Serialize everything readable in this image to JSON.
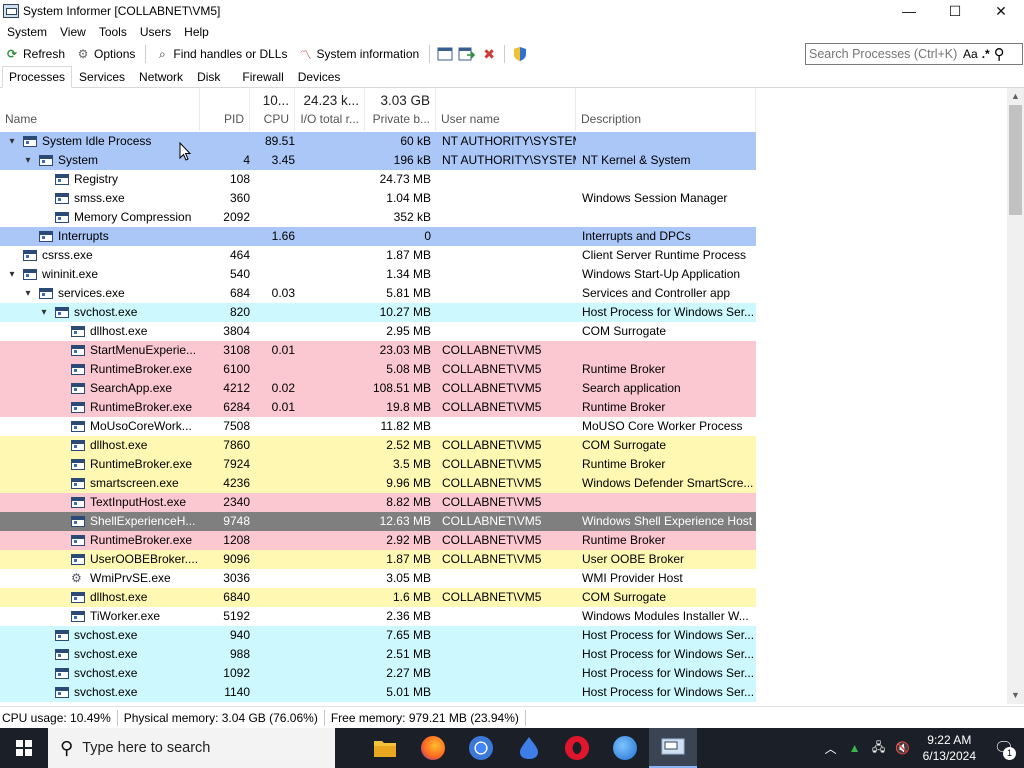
{
  "window": {
    "title": "System Informer [COLLABNET\\VM5]",
    "minimize": "—",
    "maximize": "☐",
    "close": "✕"
  },
  "menu": [
    "System",
    "View",
    "Tools",
    "Users",
    "Help"
  ],
  "toolbar": {
    "refresh": "Refresh",
    "options": "Options",
    "find_handles": "Find handles or DLLs",
    "system_information": "System information"
  },
  "search": {
    "placeholder": "Search Processes (Ctrl+K)",
    "case_label": "Aa",
    "regex_label": ".*"
  },
  "tabs": [
    "Processes",
    "Services",
    "Network",
    "Disk",
    "Firewall",
    "Devices"
  ],
  "columns": {
    "name": "Name",
    "pid": "PID",
    "cpu": "CPU",
    "io": "I/O total r...",
    "private": "Private b...",
    "user": "User name",
    "description": "Description"
  },
  "totals": {
    "cpu": "10...",
    "io": "24.23 k...",
    "private": "3.03 GB"
  },
  "colors": {
    "system": "#aac7f7",
    "service": "#cdf8fd",
    "user": "#fff8b3",
    "elevated": "#fbc8d1",
    "suspended": "#7f7f7f",
    "normal": "#ffffff"
  },
  "processes": [
    {
      "name": "System Idle Process",
      "pid": "",
      "cpu": "89.51",
      "io": "",
      "priv": "60 kB",
      "user": "NT AUTHORITY\\SYSTEM",
      "desc": "",
      "level": 0,
      "exp": "▾",
      "type": "system"
    },
    {
      "name": "System",
      "pid": "4",
      "cpu": "3.45",
      "io": "",
      "priv": "196 kB",
      "user": "NT AUTHORITY\\SYSTEM",
      "desc": "NT Kernel & System",
      "level": 1,
      "exp": "▾",
      "type": "system"
    },
    {
      "name": "Registry",
      "pid": "108",
      "cpu": "",
      "io": "",
      "priv": "24.73 MB",
      "user": "",
      "desc": "",
      "level": 2,
      "exp": "",
      "type": "normal"
    },
    {
      "name": "smss.exe",
      "pid": "360",
      "cpu": "",
      "io": "",
      "priv": "1.04 MB",
      "user": "",
      "desc": "Windows Session Manager",
      "level": 2,
      "exp": "",
      "type": "normal"
    },
    {
      "name": "Memory Compression",
      "pid": "2092",
      "cpu": "",
      "io": "",
      "priv": "352 kB",
      "user": "",
      "desc": "",
      "level": 2,
      "exp": "",
      "type": "normal"
    },
    {
      "name": "Interrupts",
      "pid": "",
      "cpu": "1.66",
      "io": "",
      "priv": "0",
      "user": "",
      "desc": "Interrupts and DPCs",
      "level": 1,
      "exp": "",
      "type": "system"
    },
    {
      "name": "csrss.exe",
      "pid": "464",
      "cpu": "",
      "io": "",
      "priv": "1.87 MB",
      "user": "",
      "desc": "Client Server Runtime Process",
      "level": 0,
      "exp": "",
      "type": "normal"
    },
    {
      "name": "wininit.exe",
      "pid": "540",
      "cpu": "",
      "io": "",
      "priv": "1.34 MB",
      "user": "",
      "desc": "Windows Start-Up Application",
      "level": 0,
      "exp": "▾",
      "type": "normal"
    },
    {
      "name": "services.exe",
      "pid": "684",
      "cpu": "0.03",
      "io": "",
      "priv": "5.81 MB",
      "user": "",
      "desc": "Services and Controller app",
      "level": 1,
      "exp": "▾",
      "type": "normal"
    },
    {
      "name": "svchost.exe",
      "pid": "820",
      "cpu": "",
      "io": "",
      "priv": "10.27 MB",
      "user": "",
      "desc": "Host Process for Windows Ser...",
      "level": 2,
      "exp": "▾",
      "type": "service"
    },
    {
      "name": "dllhost.exe",
      "pid": "3804",
      "cpu": "",
      "io": "",
      "priv": "2.95 MB",
      "user": "",
      "desc": "COM Surrogate",
      "level": 3,
      "exp": "",
      "type": "normal"
    },
    {
      "name": "StartMenuExperie...",
      "pid": "3108",
      "cpu": "0.01",
      "io": "",
      "priv": "23.03 MB",
      "user": "COLLABNET\\VM5",
      "desc": "",
      "level": 3,
      "exp": "",
      "type": "elevated"
    },
    {
      "name": "RuntimeBroker.exe",
      "pid": "6100",
      "cpu": "",
      "io": "",
      "priv": "5.08 MB",
      "user": "COLLABNET\\VM5",
      "desc": "Runtime Broker",
      "level": 3,
      "exp": "",
      "type": "elevated"
    },
    {
      "name": "SearchApp.exe",
      "pid": "4212",
      "cpu": "0.02",
      "io": "",
      "priv": "108.51 MB",
      "user": "COLLABNET\\VM5",
      "desc": "Search application",
      "level": 3,
      "exp": "",
      "type": "elevated"
    },
    {
      "name": "RuntimeBroker.exe",
      "pid": "6284",
      "cpu": "0.01",
      "io": "",
      "priv": "19.8 MB",
      "user": "COLLABNET\\VM5",
      "desc": "Runtime Broker",
      "level": 3,
      "exp": "",
      "type": "elevated"
    },
    {
      "name": "MoUsoCoreWork...",
      "pid": "7508",
      "cpu": "",
      "io": "",
      "priv": "11.82 MB",
      "user": "",
      "desc": "MoUSO Core Worker Process",
      "level": 3,
      "exp": "",
      "type": "normal"
    },
    {
      "name": "dllhost.exe",
      "pid": "7860",
      "cpu": "",
      "io": "",
      "priv": "2.52 MB",
      "user": "COLLABNET\\VM5",
      "desc": "COM Surrogate",
      "level": 3,
      "exp": "",
      "type": "user"
    },
    {
      "name": "RuntimeBroker.exe",
      "pid": "7924",
      "cpu": "",
      "io": "",
      "priv": "3.5 MB",
      "user": "COLLABNET\\VM5",
      "desc": "Runtime Broker",
      "level": 3,
      "exp": "",
      "type": "user"
    },
    {
      "name": "smartscreen.exe",
      "pid": "4236",
      "cpu": "",
      "io": "",
      "priv": "9.96 MB",
      "user": "COLLABNET\\VM5",
      "desc": "Windows Defender SmartScre...",
      "level": 3,
      "exp": "",
      "type": "user"
    },
    {
      "name": "TextInputHost.exe",
      "pid": "2340",
      "cpu": "",
      "io": "",
      "priv": "8.82 MB",
      "user": "COLLABNET\\VM5",
      "desc": "",
      "level": 3,
      "exp": "",
      "type": "elevated"
    },
    {
      "name": "ShellExperienceH...",
      "pid": "9748",
      "cpu": "",
      "io": "",
      "priv": "12.63 MB",
      "user": "COLLABNET\\VM5",
      "desc": "Windows Shell Experience Host",
      "level": 3,
      "exp": "",
      "type": "suspended"
    },
    {
      "name": "RuntimeBroker.exe",
      "pid": "1208",
      "cpu": "",
      "io": "",
      "priv": "2.92 MB",
      "user": "COLLABNET\\VM5",
      "desc": "Runtime Broker",
      "level": 3,
      "exp": "",
      "type": "elevated"
    },
    {
      "name": "UserOOBEBroker....",
      "pid": "9096",
      "cpu": "",
      "io": "",
      "priv": "1.87 MB",
      "user": "COLLABNET\\VM5",
      "desc": "User OOBE Broker",
      "level": 3,
      "exp": "",
      "type": "user"
    },
    {
      "name": "WmiPrvSE.exe",
      "pid": "3036",
      "cpu": "",
      "io": "",
      "priv": "3.05 MB",
      "user": "",
      "desc": "WMI Provider Host",
      "level": 3,
      "exp": "",
      "type": "normal",
      "icon": "gear"
    },
    {
      "name": "dllhost.exe",
      "pid": "6840",
      "cpu": "",
      "io": "",
      "priv": "1.6 MB",
      "user": "COLLABNET\\VM5",
      "desc": "COM Surrogate",
      "level": 3,
      "exp": "",
      "type": "user"
    },
    {
      "name": "TiWorker.exe",
      "pid": "5192",
      "cpu": "",
      "io": "",
      "priv": "2.36 MB",
      "user": "",
      "desc": "Windows Modules Installer W...",
      "level": 3,
      "exp": "",
      "type": "normal"
    },
    {
      "name": "svchost.exe",
      "pid": "940",
      "cpu": "",
      "io": "",
      "priv": "7.65 MB",
      "user": "",
      "desc": "Host Process for Windows Ser...",
      "level": 2,
      "exp": "",
      "type": "service"
    },
    {
      "name": "svchost.exe",
      "pid": "988",
      "cpu": "",
      "io": "",
      "priv": "2.51 MB",
      "user": "",
      "desc": "Host Process for Windows Ser...",
      "level": 2,
      "exp": "",
      "type": "service"
    },
    {
      "name": "svchost.exe",
      "pid": "1092",
      "cpu": "",
      "io": "",
      "priv": "2.27 MB",
      "user": "",
      "desc": "Host Process for Windows Ser...",
      "level": 2,
      "exp": "",
      "type": "service"
    },
    {
      "name": "svchost.exe",
      "pid": "1140",
      "cpu": "",
      "io": "",
      "priv": "5.01 MB",
      "user": "",
      "desc": "Host Process for Windows Ser...",
      "level": 2,
      "exp": "",
      "type": "service"
    }
  ],
  "status": {
    "cpu_usage": "CPU usage: 10.49%",
    "physical_memory": "Physical memory: 3.04 GB (76.06%)",
    "free_memory": "Free memory: 979.21 MB (23.94%)"
  },
  "taskbar": {
    "search_placeholder": "Type here to search",
    "time": "9:22 AM",
    "date": "6/13/2024",
    "notification_count": "1"
  }
}
